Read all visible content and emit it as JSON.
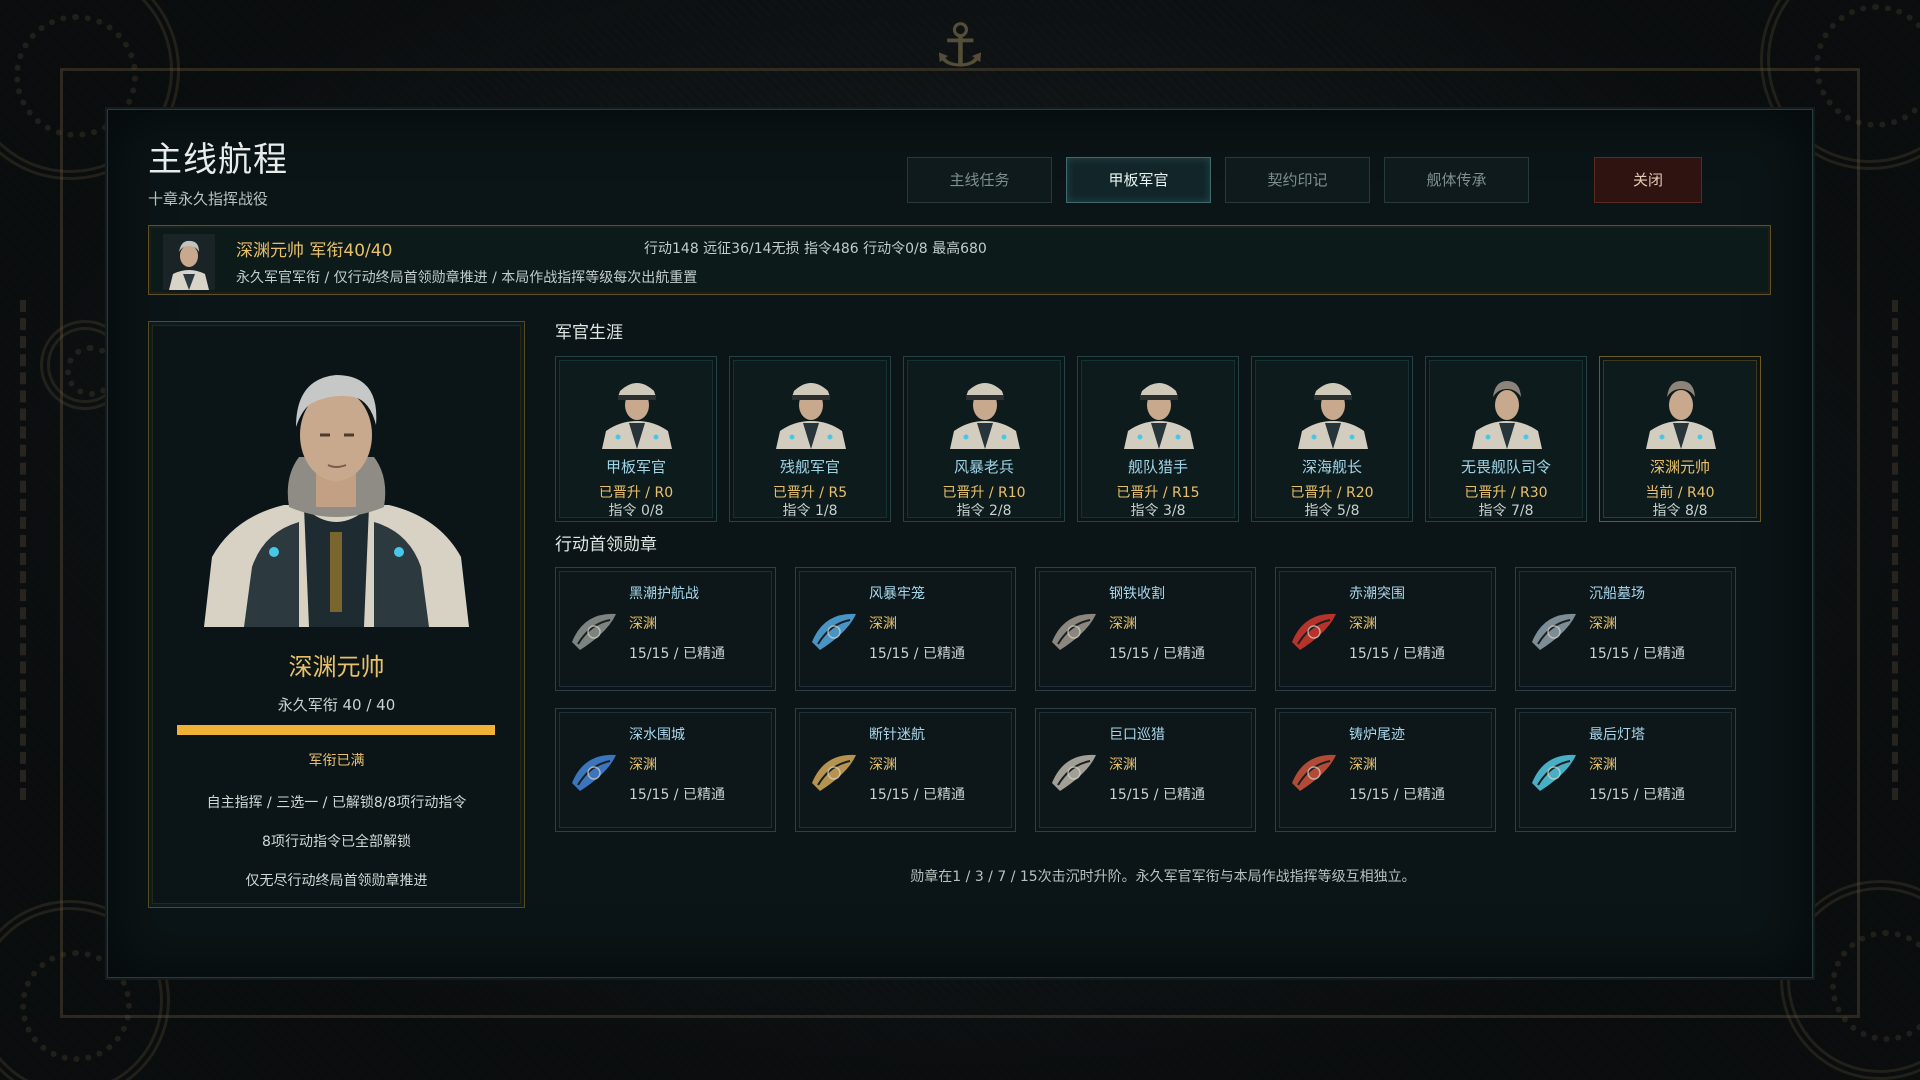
{
  "header": {
    "title": "主线航程",
    "subtitle": "十章永久指挥战役"
  },
  "tabs": [
    {
      "label": "主线任务",
      "active": false
    },
    {
      "label": "甲板军官",
      "active": true
    },
    {
      "label": "契约印记",
      "active": false
    },
    {
      "label": "舰体传承",
      "active": false
    }
  ],
  "close_label": "关闭",
  "info_bar": {
    "name_rank": "深渊元帅  军衔40/40",
    "stats": "行动148  远征36/14无损  指令486  行动令0/8  最高680",
    "description": "永久军官军衔 / 仅行动终局首领勋章推进 / 本局作战指挥等级每次出航重置"
  },
  "officer_card": {
    "name": "深渊元帅",
    "rank_text": "永久军衔 40 / 40",
    "progress": 1.0,
    "max_text": "军衔已满",
    "line1": "自主指挥 / 三选一 / 已解锁8/8项行动指令",
    "line2": "8项行动指令已全部解锁",
    "line3": "仅无尽行动终局首领勋章推进"
  },
  "career": {
    "title": "军官生涯",
    "items": [
      {
        "name": "甲板军官",
        "status": "已晋升 / R0",
        "commands": "指令 0/8",
        "current": false,
        "hat": true
      },
      {
        "name": "残舰军官",
        "status": "已晋升 / R5",
        "commands": "指令 1/8",
        "current": false,
        "hat": true
      },
      {
        "name": "风暴老兵",
        "status": "已晋升 / R10",
        "commands": "指令 2/8",
        "current": false,
        "hat": true
      },
      {
        "name": "舰队猎手",
        "status": "已晋升 / R15",
        "commands": "指令 3/8",
        "current": false,
        "hat": true
      },
      {
        "name": "深海舰长",
        "status": "已晋升 / R20",
        "commands": "指令 5/8",
        "current": false,
        "hat": true
      },
      {
        "name": "无畏舰队司令",
        "status": "已晋升 / R30",
        "commands": "指令 7/8",
        "current": false,
        "hat": false
      },
      {
        "name": "深渊元帅",
        "status": "当前 / R40",
        "commands": "指令 8/8",
        "current": true,
        "hat": false
      }
    ]
  },
  "medals": {
    "title": "行动首领勋章",
    "items": [
      {
        "name": "黑潮护航战",
        "tier": "深渊",
        "progress": "15/15 / 已精通",
        "icon": "dark-blade-icon",
        "color": "#8a8f8c"
      },
      {
        "name": "风暴牢笼",
        "tier": "深渊",
        "progress": "15/15 / 已精通",
        "icon": "storm-cage-icon",
        "color": "#4fa3d8"
      },
      {
        "name": "钢铁收割",
        "tier": "深渊",
        "progress": "15/15 / 已精通",
        "icon": "steel-reaper-icon",
        "color": "#9a948a"
      },
      {
        "name": "赤潮突围",
        "tier": "深渊",
        "progress": "15/15 / 已精通",
        "icon": "red-tide-icon",
        "color": "#c9352c"
      },
      {
        "name": "沉船墓场",
        "tier": "深渊",
        "progress": "15/15 / 已精通",
        "icon": "wreck-graveyard-icon",
        "color": "#8a9aa4"
      },
      {
        "name": "深水围城",
        "tier": "深渊",
        "progress": "15/15 / 已精通",
        "icon": "deep-siege-icon",
        "color": "#3f7fd0"
      },
      {
        "name": "断针迷航",
        "tier": "深渊",
        "progress": "15/15 / 已精通",
        "icon": "broken-compass-icon",
        "color": "#c9a255"
      },
      {
        "name": "巨口巡猎",
        "tier": "深渊",
        "progress": "15/15 / 已精通",
        "icon": "giant-maw-icon",
        "color": "#b3aea4"
      },
      {
        "name": "铸炉尾迹",
        "tier": "深渊",
        "progress": "15/15 / 已精通",
        "icon": "forge-wake-icon",
        "color": "#c4503a"
      },
      {
        "name": "最后灯塔",
        "tier": "深渊",
        "progress": "15/15 / 已精通",
        "icon": "last-lighthouse-icon",
        "color": "#4fc0d8"
      }
    ]
  },
  "footnote": "勋章在1 / 3 / 7 / 15次击沉时升阶。永久军官军衔与本局作战指挥等级互相独立。"
}
